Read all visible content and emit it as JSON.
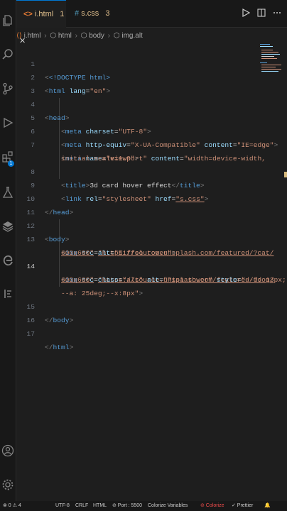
{
  "tabs": [
    {
      "icon": "<>",
      "name": "i.html",
      "count": "1",
      "close": "✕"
    },
    {
      "icon": "#",
      "name": "s.css",
      "count": "3"
    }
  ],
  "breadcrumb": [
    "i.html",
    "html",
    "body",
    "img.alt"
  ],
  "editor": {
    "current_line": "14",
    "lines": [
      {
        "num": "1"
      },
      {
        "num": "2"
      },
      {
        "num": "3"
      },
      {
        "num": "4"
      },
      {
        "num": "5"
      },
      {
        "num": "6"
      },
      {
        "num": "7"
      },
      {
        "num": "8"
      },
      {
        "num": "9"
      },
      {
        "num": "10"
      },
      {
        "num": "11"
      },
      {
        "num": "12"
      },
      {
        "num": "13"
      },
      {
        "num": "14"
      },
      {
        "num": "15"
      },
      {
        "num": "16"
      },
      {
        "num": "17"
      }
    ],
    "code": {
      "l1": "<!DOCTYPE html>",
      "l2_tag": "html",
      "l2_attr": "lang",
      "l2_val": "\"en\"",
      "l4": "head",
      "l5_attr": "charset",
      "l5_val": "\"UTF-8\"",
      "l6_attr1": "http-equiv",
      "l6_val1": "\"X-UA-Compatible\"",
      "l6_attr2": "content",
      "l6_val2": "\"IE=edge\"",
      "l7_attr1": "name",
      "l7_val1": "\"viewport\"",
      "l7_attr2": "content",
      "l7_val2": "\"width=device-width,",
      "l7b_val": "initial-scale=1.0\"",
      "l8_text": "3d card hover effect",
      "l9_attr1": "rel",
      "l9_val1": "\"stylesheet\"",
      "l9_attr2": "href",
      "l9_val2": "\"s.css\"",
      "l12": "body",
      "l13_attr": "src",
      "l13_val": "\"https://source.unsplash.com/featured/?cat/",
      "l13b_val": "600x600\"",
      "l13b_attr": "alt",
      "l13b_val2": "\"Eiffel tower\"",
      "l14_attr": "src",
      "l14_val": "\"https://source.unsplash.com/featured/?dog/",
      "l14b_val": "600x600\"",
      "l14b_attr1": "class",
      "l14b_val1": "\"alt\"",
      "l14b_attr2": "alt",
      "l14b_val2": "\"Pisa tower\"",
      "l14b_attr3": "style",
      "l14b_val3": "\"--d: 13px;",
      "l14c_val": "--a: 25deg;--x:8px\""
    }
  },
  "status": {
    "left": "⊗ 0 ⚠ 4",
    "encoding": "UTF-8",
    "eol": "CRLF",
    "lang": "HTML",
    "port": "⊘ Port : 5500",
    "colorize": "Colorize Variables",
    "colorize2": "⊘ Colorize",
    "prettier": "✓ Prettier"
  },
  "colors": {
    "accent": "#0078d4",
    "background": "#1e1e1e",
    "tag": "#569cd6",
    "attribute": "#9cdcfe",
    "string": "#ce9178"
  }
}
